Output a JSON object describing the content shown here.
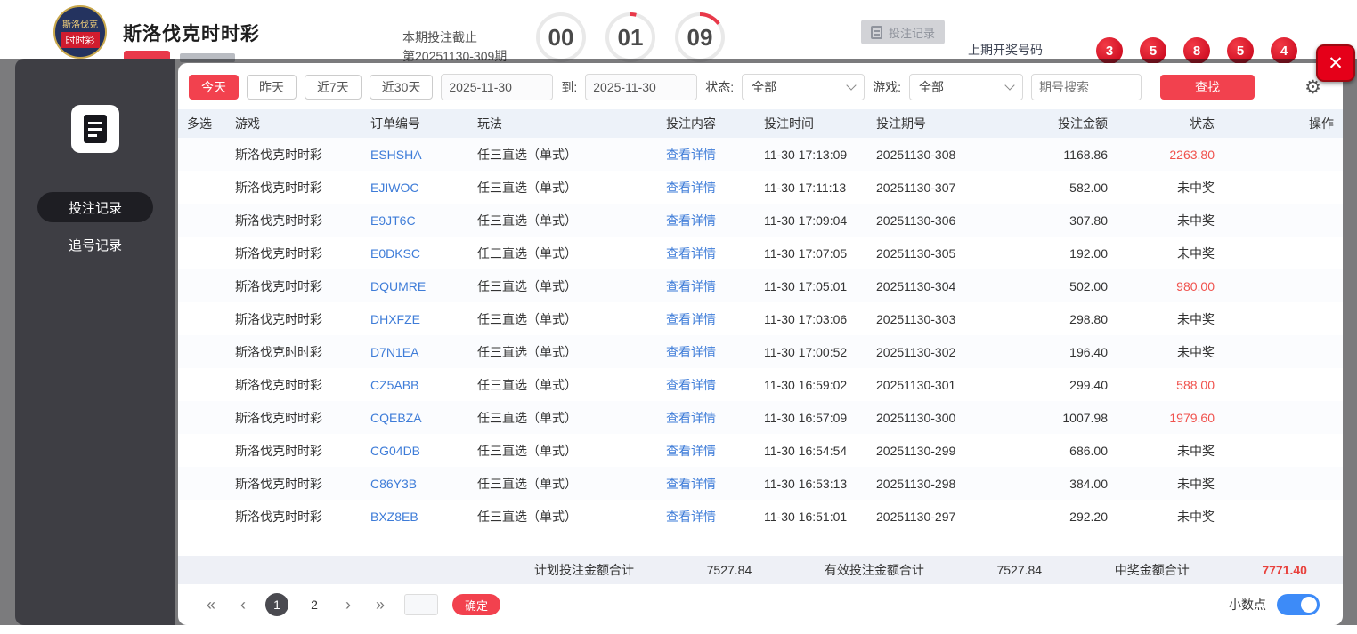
{
  "header": {
    "logo_text_top": "斯洛伐克",
    "logo_text_bottom": "时时彩",
    "title": "斯洛伐克时时彩",
    "deadline_label": "本期投注截止",
    "current_period": "第20251130-309期",
    "countdown": {
      "hours": "00",
      "minutes": "01",
      "seconds": "09"
    },
    "records_button_label": "投注记录",
    "last_draw_label": "上期开奖号码",
    "last_draw_numbers": [
      "3",
      "5",
      "8",
      "5",
      "4"
    ]
  },
  "sidebar": {
    "items": [
      {
        "label": "投注记录",
        "active": true
      },
      {
        "label": "追号记录",
        "active": false
      }
    ]
  },
  "modal": {
    "close_label": "✕"
  },
  "filters": {
    "quick_ranges": [
      "今天",
      "昨天",
      "近7天",
      "近30天"
    ],
    "active_range": "今天",
    "date_from": "2025-11-30",
    "to_label": "到:",
    "date_to": "2025-11-30",
    "status_label": "状态:",
    "status_value": "全部",
    "game_label": "游戏:",
    "game_value": "全部",
    "search_placeholder": "期号搜索",
    "search_button_label": "查找"
  },
  "table": {
    "columns": [
      "多选",
      "游戏",
      "订单编号",
      "玩法",
      "投注内容",
      "投注时间",
      "投注期号",
      "投注金额",
      "状态",
      "操作"
    ],
    "rows": [
      {
        "game": "斯洛伐克时时彩",
        "order_id": "ESHSHA",
        "play": "任三直选（单式）",
        "content_link": "查看详情",
        "time": "11-30 17:13:09",
        "period": "20251130-308",
        "amount": "1168.86",
        "status": "2263.80",
        "won": true
      },
      {
        "game": "斯洛伐克时时彩",
        "order_id": "EJIWOC",
        "play": "任三直选（单式）",
        "content_link": "查看详情",
        "time": "11-30 17:11:13",
        "period": "20251130-307",
        "amount": "582.00",
        "status": "未中奖",
        "won": false
      },
      {
        "game": "斯洛伐克时时彩",
        "order_id": "E9JT6C",
        "play": "任三直选（单式）",
        "content_link": "查看详情",
        "time": "11-30 17:09:04",
        "period": "20251130-306",
        "amount": "307.80",
        "status": "未中奖",
        "won": false
      },
      {
        "game": "斯洛伐克时时彩",
        "order_id": "E0DKSC",
        "play": "任三直选（单式）",
        "content_link": "查看详情",
        "time": "11-30 17:07:05",
        "period": "20251130-305",
        "amount": "192.00",
        "status": "未中奖",
        "won": false
      },
      {
        "game": "斯洛伐克时时彩",
        "order_id": "DQUMRE",
        "play": "任三直选（单式）",
        "content_link": "查看详情",
        "time": "11-30 17:05:01",
        "period": "20251130-304",
        "amount": "502.00",
        "status": "980.00",
        "won": true
      },
      {
        "game": "斯洛伐克时时彩",
        "order_id": "DHXFZE",
        "play": "任三直选（单式）",
        "content_link": "查看详情",
        "time": "11-30 17:03:06",
        "period": "20251130-303",
        "amount": "298.80",
        "status": "未中奖",
        "won": false
      },
      {
        "game": "斯洛伐克时时彩",
        "order_id": "D7N1EA",
        "play": "任三直选（单式）",
        "content_link": "查看详情",
        "time": "11-30 17:00:52",
        "period": "20251130-302",
        "amount": "196.40",
        "status": "未中奖",
        "won": false
      },
      {
        "game": "斯洛伐克时时彩",
        "order_id": "CZ5ABB",
        "play": "任三直选（单式）",
        "content_link": "查看详情",
        "time": "11-30 16:59:02",
        "period": "20251130-301",
        "amount": "299.40",
        "status": "588.00",
        "won": true
      },
      {
        "game": "斯洛伐克时时彩",
        "order_id": "CQEBZA",
        "play": "任三直选（单式）",
        "content_link": "查看详情",
        "time": "11-30 16:57:09",
        "period": "20251130-300",
        "amount": "1007.98",
        "status": "1979.60",
        "won": true
      },
      {
        "game": "斯洛伐克时时彩",
        "order_id": "CG04DB",
        "play": "任三直选（单式）",
        "content_link": "查看详情",
        "time": "11-30 16:54:54",
        "period": "20251130-299",
        "amount": "686.00",
        "status": "未中奖",
        "won": false
      },
      {
        "game": "斯洛伐克时时彩",
        "order_id": "C86Y3B",
        "play": "任三直选（单式）",
        "content_link": "查看详情",
        "time": "11-30 16:53:13",
        "period": "20251130-298",
        "amount": "384.00",
        "status": "未中奖",
        "won": false
      },
      {
        "game": "斯洛伐克时时彩",
        "order_id": "BXZ8EB",
        "play": "任三直选（单式）",
        "content_link": "查看详情",
        "time": "11-30 16:51:01",
        "period": "20251130-297",
        "amount": "292.20",
        "status": "未中奖",
        "won": false
      }
    ],
    "summary": {
      "plan_label": "计划投注金额合计",
      "plan_value": "7527.84",
      "valid_label": "有效投注金额合计",
      "valid_value": "7527.84",
      "win_label": "中奖金额合计",
      "win_value": "7771.40"
    }
  },
  "pagination": {
    "first": "«",
    "prev": "‹",
    "pages": [
      "1",
      "2"
    ],
    "current": "1",
    "next": "›",
    "last": "»",
    "confirm_label": "确定",
    "decimal_label": "小数点",
    "decimal_on": true
  },
  "colors": {
    "accent_red": "#f2414e",
    "ball_red": "#e50019",
    "link_blue": "#3e7cd8",
    "win_red": "#f0524d",
    "toggle_blue": "#3d8bf8",
    "table_head_bg": "#edf2f9"
  }
}
